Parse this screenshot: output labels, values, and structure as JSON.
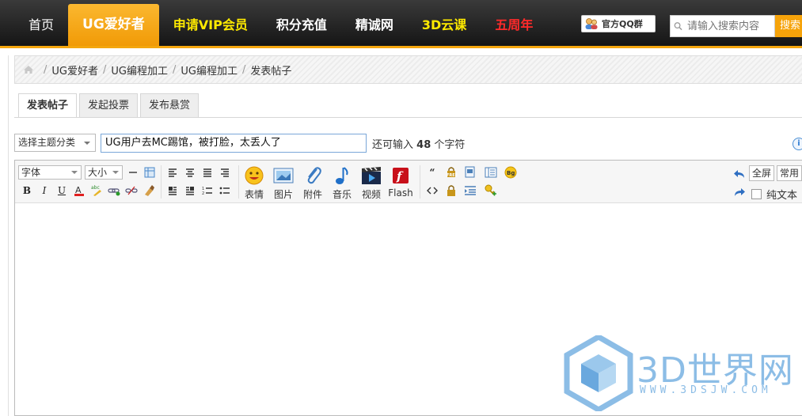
{
  "nav": {
    "items": [
      {
        "label": "首页",
        "style": "home"
      },
      {
        "label": "UG爱好者",
        "style": "active"
      },
      {
        "label": "申请VIP会员",
        "style": "yellow"
      },
      {
        "label": "积分充值",
        "style": "normal"
      },
      {
        "label": "精诚网",
        "style": "normal"
      },
      {
        "label": "3D云课",
        "style": "yellow"
      },
      {
        "label": "五周年",
        "style": "red"
      }
    ],
    "qq_label": "官方QQ群",
    "search_placeholder": "请输入搜索内容",
    "search_button": "搜索"
  },
  "breadcrumb": {
    "items": [
      "UG爱好者",
      "UG编程加工",
      "UG编程加工",
      "发表帖子"
    ]
  },
  "tabs": [
    {
      "label": "发表帖子",
      "active": true
    },
    {
      "label": "发起投票",
      "active": false
    },
    {
      "label": "发布悬赏",
      "active": false
    }
  ],
  "form": {
    "category": "选择主题分类",
    "subject": "UG用户去MC踢馆，被打脸，太丢人了",
    "remain_prefix": "还可输入",
    "remain_count": "48",
    "remain_suffix": "个字符"
  },
  "editor": {
    "font_select": "字体",
    "size_select": "大小",
    "media": [
      {
        "label": "表情",
        "icon": "smiley-icon"
      },
      {
        "label": "图片",
        "icon": "image-icon"
      },
      {
        "label": "附件",
        "icon": "paperclip-icon"
      },
      {
        "label": "音乐",
        "icon": "music-note-icon"
      },
      {
        "label": "视频",
        "icon": "video-icon"
      },
      {
        "label": "Flash",
        "icon": "flash-icon"
      }
    ],
    "fullscreen": "全屏",
    "common": "常用",
    "plain_text": "纯文本"
  },
  "watermark": {
    "text": "3D世界网",
    "url": "WWW.3DSJW.COM"
  },
  "colors": {
    "accent": "#f6a30a",
    "nav_bg": "#1e1e1e",
    "vip_yellow": "#ffea00",
    "anniv_red": "#ff2a2a",
    "watermark": "#8cbde6"
  }
}
